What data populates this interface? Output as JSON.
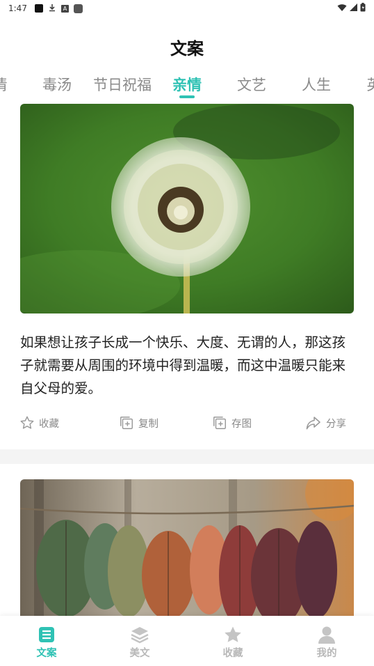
{
  "status_bar": {
    "time": "1:47"
  },
  "header": {
    "title": "文案"
  },
  "tabs": [
    {
      "label": "情"
    },
    {
      "label": "毒汤"
    },
    {
      "label": "节日祝福"
    },
    {
      "label": "亲情",
      "active": true
    },
    {
      "label": "文艺"
    },
    {
      "label": "人生"
    },
    {
      "label": "英"
    }
  ],
  "colors": {
    "accent": "#2fc2b4",
    "inactive": "#b8b8b8",
    "tab_inactive": "#8a8a8a"
  },
  "posts": [
    {
      "image": "dandelion-photo",
      "text": "如果想让孩子长成一个快乐、大度、无谓的人，那这孩子就需要从周围的环境中得到温暖，而这中温暖只能来自父母的爱。",
      "actions": {
        "favorite": "收藏",
        "copy": "复制",
        "save_image": "存图",
        "share": "分享"
      }
    },
    {
      "image": "fabric-leaves-photo"
    }
  ],
  "bottom_nav": [
    {
      "label": "文案",
      "icon": "document-icon",
      "active": true
    },
    {
      "label": "美文",
      "icon": "layers-icon"
    },
    {
      "label": "收藏",
      "icon": "star-icon"
    },
    {
      "label": "我的",
      "icon": "person-icon"
    }
  ]
}
